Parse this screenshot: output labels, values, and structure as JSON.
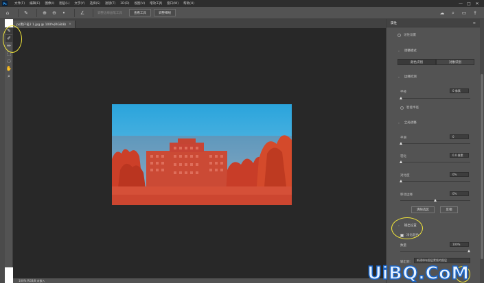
{
  "app": {
    "logo_text": "Ps",
    "menu": [
      "文件(F)",
      "编辑(E)",
      "图像(I)",
      "图层(L)",
      "文字(Y)",
      "选择(S)",
      "滤镜(T)",
      "3D(D)",
      "视图(V)",
      "增效工具",
      "窗口(W)",
      "帮助(H)"
    ],
    "window_controls": [
      "—",
      "□",
      "✕"
    ]
  },
  "options_bar": {
    "home_icon": "home-icon",
    "dim_text": "调整边缘画笔工具",
    "btn_1": "查看工具",
    "btn_2": "调整细线"
  },
  "document": {
    "tab_label": "ps用户名2 1.jpg @ 100%(RGB/8)",
    "tab_close": "×"
  },
  "status": {
    "text": "100%   RGB/8 未嵌入"
  },
  "panel": {
    "title": "属性",
    "view_mode_label": "记住设置",
    "section_view": "调整模式",
    "seg_color": "颜色识别",
    "seg_object": "对象识别",
    "section_edge": "边缘检测",
    "radius_label": "半径",
    "radius_value": "0 像素",
    "smart_radius": "智能半径",
    "section_global": "全局调整",
    "smooth_label": "平滑",
    "smooth_value": "0",
    "feather_label": "羽化",
    "feather_value": "0.0 像素",
    "contrast_label": "对比度",
    "contrast_value": "0%",
    "shift_label": "移动边缘",
    "shift_value": "0%",
    "clear_btn": "清除选区",
    "invert_btn": "反相",
    "section_output": "输出设置",
    "decontam_label": "净化颜色",
    "amount_label": "数量",
    "amount_value": "100%",
    "output_to_label": "输出到:",
    "output_to_value": "新建带有图层蒙版的图层"
  },
  "watermark": {
    "text": "UiBQ.CoM"
  },
  "colors": {
    "accent_yellow": "#f2e63a",
    "watermark_blue": "#1a66c9"
  }
}
